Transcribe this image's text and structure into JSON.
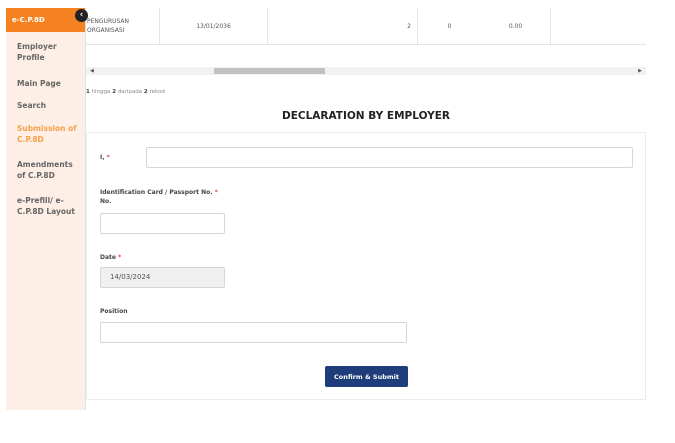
{
  "sidebar": {
    "header": "e-C.P.8D",
    "items": [
      {
        "label": "Employer Profile"
      },
      {
        "label": "Main Page"
      },
      {
        "label": "Search"
      },
      {
        "label": "Submission of C.P.8D"
      },
      {
        "label": "Amendments of C.P.8D"
      },
      {
        "label": "e-Prefill/ e-C.P.8D Layout"
      }
    ],
    "toggle_icon": "chevron-left-icon"
  },
  "table": {
    "row": {
      "name": "PENGURUSAN ORGANISASI",
      "date": "13/01/2036",
      "count": "2",
      "zero": "0",
      "amount": "0.00"
    }
  },
  "pagination": {
    "prefix": "1",
    "middle": " hingga ",
    "to": "2",
    "of_text": " daripada ",
    "total": "2",
    "suffix": " rekod"
  },
  "declaration": {
    "title": "DECLARATION BY EMPLOYER",
    "name_label": "I,",
    "name_value": "",
    "id_label": "Identification Card  / Passport No.",
    "id_label_line2": "No.",
    "id_value": "",
    "date_label": "Date",
    "date_value": "14/03/2024",
    "position_label": "Position",
    "position_value": "",
    "required_mark": "*",
    "submit_label": "Confirm & Submit"
  },
  "colors": {
    "accent": "#f58220",
    "sidebar_bg": "#fdeee6",
    "button": "#1f3d7a",
    "active_nav": "#f5a14a"
  }
}
